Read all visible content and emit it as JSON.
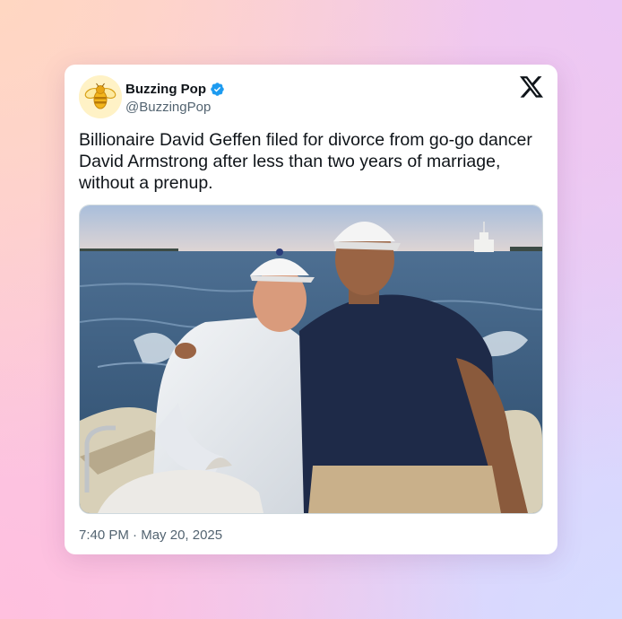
{
  "tweet": {
    "author": {
      "display_name": "Buzzing Pop",
      "handle": "@BuzzingPop",
      "verified": true,
      "avatar_icon": "bee-icon"
    },
    "platform_icon": "x-logo-icon",
    "text": "Billionaire David Geffen filed for divorce from go-go dancer David Armstrong after less than two years of marriage, without a prenup.",
    "media": {
      "type": "photo",
      "description_icon": "photo-two-men-on-boat"
    },
    "time": "7:40 PM",
    "separator": "·",
    "date": "May 20, 2025"
  },
  "colors": {
    "verified_blue": "#1d9bf0",
    "text_primary": "#0f1419",
    "text_secondary": "#536471",
    "card_background": "#ffffff"
  }
}
